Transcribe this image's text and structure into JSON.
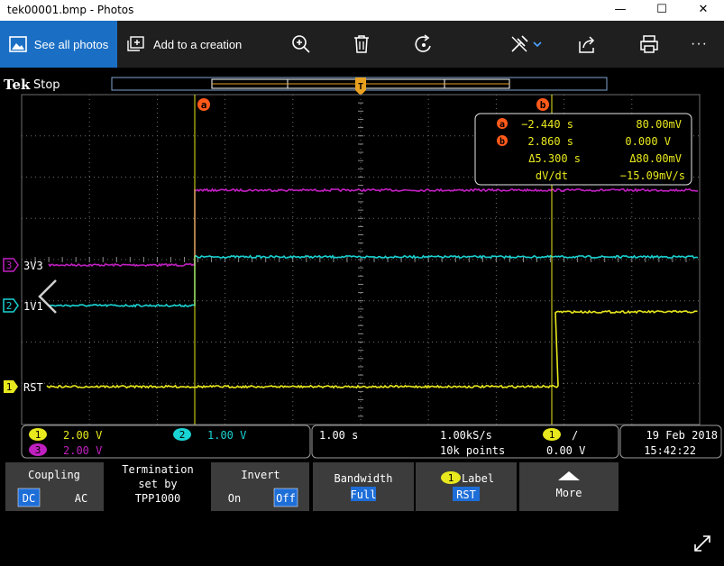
{
  "window": {
    "title": "tek00001.bmp - Photos",
    "minimize_glyph": "—",
    "maximize_glyph": "☐",
    "close_glyph": "✕"
  },
  "toolbar": {
    "see_all_photos": "See all photos",
    "add_to_creation": "Add to a creation",
    "icons": [
      "photos-icon",
      "add-creation-icon",
      "zoom-in-icon",
      "delete-icon",
      "rotate-icon",
      "edit-icon",
      "chevron-down-icon",
      "share-icon",
      "print-icon",
      "more-icon"
    ],
    "more_glyph": "···"
  },
  "colors": {
    "photos_accent": "#1a6fc4",
    "ch1": "#e8e81e",
    "ch2": "#1ad3d3",
    "ch3": "#c020c0",
    "cursor": "#e8e81e",
    "cursor_label": "#ff5a1a",
    "grid": "#6e6e6e",
    "panel_border": "#9a9a9a",
    "softkey_bg": "#3c3c3c",
    "softkey_sel": "#1e6ed8"
  },
  "scope": {
    "brand": "Tek",
    "state": "Stop",
    "trigger_marker": "T",
    "cursor_a_label": "a",
    "cursor_b_label": "b",
    "channel_labels": [
      {
        "id": "3",
        "text": "3V3"
      },
      {
        "id": "2",
        "text": "1V1"
      },
      {
        "id": "1",
        "text": "RST"
      }
    ],
    "cursor_readout": {
      "a_time": "−2.440 s",
      "a_value": "80.00mV",
      "b_time": "2.860 s",
      "b_value": "0.000 V",
      "delta_time": "Δ5.300 s",
      "delta_value": "Δ80.00mV",
      "slope_label": "dV/dt",
      "slope_value": "−15.09mV/s"
    },
    "channel_scales": {
      "ch1": "2.00 V",
      "ch2": "1.00 V",
      "ch3": "2.00 V"
    },
    "timebase": {
      "time_div": "1.00 s",
      "sample_rate": "1.00kS/s",
      "record_length": "10k points",
      "trigger_channel": "1",
      "trigger_slope": "/",
      "trigger_level": "0.00 V"
    },
    "date": "19 Feb  2018",
    "time": "15:42:22",
    "softkeys": [
      {
        "title": "Coupling",
        "options": [
          "DC",
          "AC"
        ],
        "selected": "DC"
      },
      {
        "title": "Termination\nset by\nTPP1000"
      },
      {
        "title": "Invert",
        "options": [
          "On",
          "Off"
        ],
        "selected": "Off"
      },
      {
        "title": "Bandwidth",
        "value": "Full"
      },
      {
        "title": "Label",
        "value": "RST",
        "badge": "1"
      },
      {
        "title": "More"
      }
    ]
  },
  "viewer": {
    "expand_icon": "expand-icon"
  }
}
